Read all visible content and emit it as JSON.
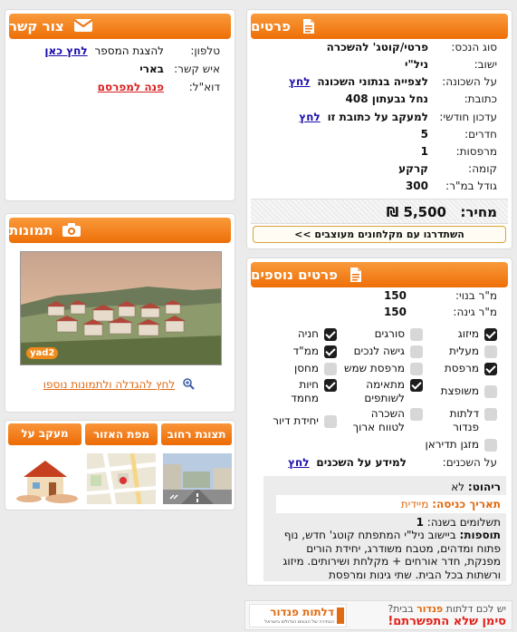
{
  "details": {
    "title": "פרטים",
    "rows": [
      {
        "label": "סוג הנכס:",
        "value": "פרטי/קוטג' להשכרה"
      },
      {
        "label": "ישוב:",
        "value": "ניל\"י"
      },
      {
        "label": "על השכונה:",
        "value": "לצפייה בנתוני השכונה",
        "link": "לחץ"
      },
      {
        "label": "כתובת:",
        "value": "נחל גבעתון 408"
      },
      {
        "label": "עדכון חודשי:",
        "value": "למעקב על כתובת זו",
        "link": "לחץ"
      },
      {
        "label": "חדרים:",
        "value": "5"
      },
      {
        "label": "מרפסות:",
        "value": "1"
      },
      {
        "label": "קומה:",
        "value": "קרקע"
      },
      {
        "label": "גודל במ\"ר:",
        "value": "300"
      }
    ],
    "price_label": "מחיר:",
    "price_value": "5,500 ₪",
    "upgrade_button": "השתדרגו עם מקלחונים מעוצבים >>"
  },
  "contact": {
    "title": "צור קשר",
    "phone_label": "טלפון:",
    "phone_text": "להצגת המספר",
    "phone_link": "לחץ כאן",
    "person_label": "איש קשר:",
    "person_value": "בארי",
    "email_label": "דוא\"ל:",
    "email_link": "פנה למפרסם"
  },
  "photos": {
    "title": "תמונות",
    "badge": "yad2",
    "enlarge_link": "לחץ להגדלה ולתמונות נוספו"
  },
  "more": {
    "title": "פרטים נוספים",
    "built_label": "מ\"ר בנוי:",
    "built_value": "150",
    "garden_label": "מ\"ר גינה:",
    "garden_value": "150",
    "features": [
      {
        "label": "מיזוג",
        "on": true
      },
      {
        "label": "סורגים",
        "on": false
      },
      {
        "label": "חניה",
        "on": true
      },
      {
        "label": "מעלית",
        "on": false
      },
      {
        "label": "גישה לנכים",
        "on": false
      },
      {
        "label": "ממ\"ד",
        "on": true
      },
      {
        "label": "מרפסת",
        "on": true
      },
      {
        "label": "מרפסת שמש",
        "on": false
      },
      {
        "label": "מחסן",
        "on": false
      },
      {
        "label": "משופצת",
        "on": false
      },
      {
        "label": "מתאימה לשותפים",
        "on": true
      },
      {
        "label": "חיות מחמד",
        "on": true
      },
      {
        "label": "דלתות פנדור",
        "on": false
      },
      {
        "label": "השכרה לטווח ארוך",
        "on": false
      },
      {
        "label": "יחידת דיור",
        "on": false
      },
      {
        "label": "מזגן תדיראן",
        "on": false
      }
    ],
    "tenants_label": "על השכנים:",
    "tenants_text": "למידע על השכנים",
    "tenants_link": "לחץ",
    "furniture_label": "ריהוט:",
    "furniture_value": "לא",
    "entry_label": "תאריך כניסה:",
    "entry_value": "מיידית",
    "payments_label": "תשלומים בשנה:",
    "payments_value": "1",
    "extras_label": "תוספות:",
    "extras_text": "ביישוב ניל\"י המתפתח קוטג' חדש, נוף פתוח ומדהים, מטבח משודרג, יחידת הורים מפנקת, חדר אורחים + מקלחת ושירותים. מיזוג ורשתות בכל הבית. שתי גינות ומרפסת"
  },
  "tabs": {
    "street": "תצוגת רחוב",
    "map": "מפת האזור",
    "track": "מעקב על הנכס"
  },
  "ad": {
    "line1_prefix": "יש לכם דלתות",
    "line1_brand": "פנדור",
    "line1_suffix": "בבית?",
    "line2": "סימן שלא התפשרתם!",
    "logo": "דלתות פנדור",
    "logo_sub": "הבחירה של הבונים הגדולים בישראל"
  },
  "colors": {
    "accent": "#ef7410",
    "link": "#1a0dab",
    "red": "#d91e1e"
  }
}
